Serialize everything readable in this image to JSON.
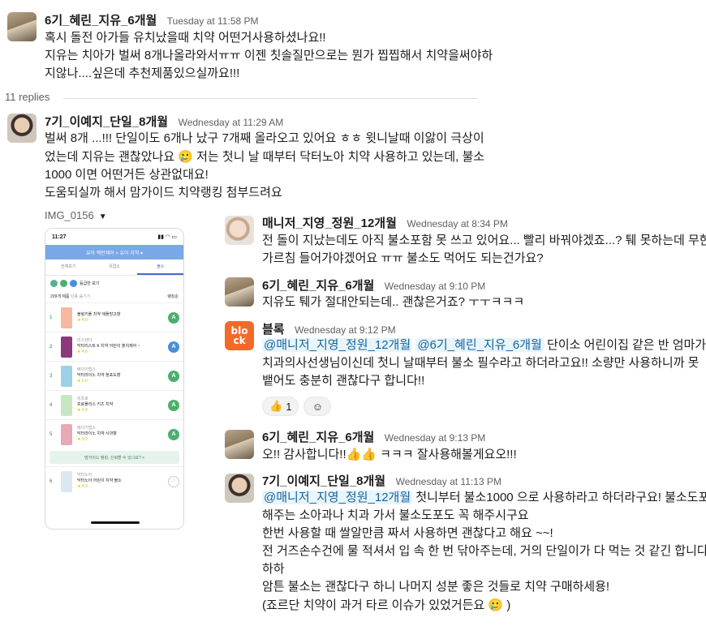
{
  "parent": {
    "author": "6기_혜린_지유_6개월",
    "time": "Tuesday at 11:58 PM",
    "lines": [
      "혹시 돌전 아가들 유치났을때 치약 어떤거사용하셨나요!!",
      "지유는 치아가 벌써 8개나올라와서ㅠㅠ 이젠 칫솔질만으로는 뭔가 찝찝해서 치약을써야하",
      "지않나....싶은데 추천제품있으실까요!!!"
    ]
  },
  "thread": {
    "replies_label": "11 replies"
  },
  "reply1": {
    "author": "7기_이예지_단일_8개월",
    "time": "Wednesday at 11:29 AM",
    "lines": [
      "벌써 8개 ...!!! 단일이도 6개나 났구 7개째 올라오고 있어요 ㅎㅎ 윗니날때 이앓이 극상이",
      "었는데 지유는 괜찮았나요",
      " 저는 첫니 날 때부터 닥터노아 치약 사용하고 있는데, 불소",
      "1000 이면 어떤거든 상관없대요!",
      "도움되실까 해서 맘가이드 치약랭킹 첨부드려요"
    ],
    "emoji": "🥲",
    "file_name": "IMG_0156"
  },
  "phone": {
    "time": "11:27",
    "nav_title": "유아 액탄제어 > 유아 치약 ▾",
    "tabs": [
      "전체보기",
      "유럽소",
      "불소"
    ],
    "filter": "등급만 보기",
    "filter2": "단종 숨기기",
    "count": "209개 제품",
    "sort": "랭킹순",
    "items": [
      {
        "rank": "1",
        "brand": "",
        "name": "블링키플 치약 애플망고향",
        "rating": "★ 4.9",
        "grade": "A",
        "color": "#f4b9a0"
      },
      {
        "rank": "2",
        "brand": "미스텐더",
        "name": "닥터리스트 K 치약 어린이 출치제어 ~",
        "rating": "★ 4.8",
        "grade": "A",
        "color": "#8a3a7a"
      },
      {
        "rank": "3",
        "brand": "베이키랩스",
        "name": "닥터라이노 치약 청포도향",
        "rating": "★ 5.0",
        "grade": "A",
        "color": "#9bd0e6"
      },
      {
        "rank": "4",
        "brand": "비프로",
        "name": "프로폴리스 키즈 치약",
        "rating": "★ 4.8",
        "grade": "A",
        "color": "#c9e6c4"
      },
      {
        "rank": "5",
        "brand": "베이키랩스",
        "name": "닥터라이노 치약 사과향",
        "rating": "★ 5.0",
        "grade": "A",
        "color": "#e6a9b5"
      }
    ],
    "banner": "맘가이드 랭킹, 신뢰할 수 있나요? >",
    "item6": {
      "rank": "6",
      "brand": "닥터노아",
      "name": "닥터노아 어린이 치약 불소",
      "rating": "★ 4.9",
      "color": "#dde7ef"
    }
  },
  "reply2": {
    "author": "매니저_지영_정원_12개월",
    "time": "Wednesday at 8:34 PM",
    "lines": [
      "전 돌이 지났는데도 아직 불소포함 못 쓰고 있어요... 빨리 바꿔야겠죠...? 퉤 못하는데 무한",
      "가르침 들어가야겠어요 ㅠㅠ 불소도 먹어도 되는건가요?"
    ]
  },
  "reply3": {
    "author": "6기_혜린_지유_6개월",
    "time": "Wednesday at 9:10 PM",
    "lines": [
      "지유도 퉤가 절대안되는데.. 괜찮은거죠? ㅜㅜㅋㅋㅋ"
    ]
  },
  "reply4": {
    "author": "블록",
    "time": "Wednesday at 9:12 PM",
    "mention1": "@매니저_지영_정원_12개월",
    "mention2": "@6기_혜린_지유_6개월",
    "line1_rest": " 단이소 어린이집 같은 반 엄마가",
    "lines": [
      "치과의사선생님이신데 첫니 날때부터 불소 필수라고 하더라고요!! 소량만 사용하니까 못",
      "뱉어도 충분히 괜찮다구 합니다!!"
    ],
    "logo_text": [
      "blo",
      "ck"
    ],
    "reaction_emoji": "👍",
    "reaction_count": "1",
    "add_reaction_icon": "☺"
  },
  "reply5": {
    "author": "6기_혜린_지유_6개월",
    "time": "Wednesday at 9:13 PM",
    "text_a": "오!! 감사합니다!!",
    "emoji": "👍👍",
    "text_b": " ㅋㅋㅋ 잘사용해볼게요오!!!"
  },
  "reply6": {
    "author": "7기_이예지_단일_8개월",
    "time": "Wednesday at 11:13 PM",
    "mention": "@매니저_지영_정원_12개월",
    "line1_rest": " 첫니부터 불소1000 으로 사용하라고 하더라구요! 불소도포",
    "lines": [
      "해주는 소아과나 치과 가서 불소도포도 꼭 해주시구요",
      "한번 사용할 때 쌀알만큼 짜서 사용하면 괜찮다고 해요 ~~!",
      "전 거즈손수건에 물 적셔서 입 속 한 번 닦아주는데, 거의 단일이가 다 먹는 것 같긴 합니다",
      "하하",
      "암튼 불소는 괜찮다구 하니 나머지 성분 좋은 것들로 치약 구매하세용!"
    ],
    "last_a": "(죠르단 치약이 과거 타르 이슈가 있었거든요",
    "emoji": "🥲",
    "last_b": " )"
  }
}
